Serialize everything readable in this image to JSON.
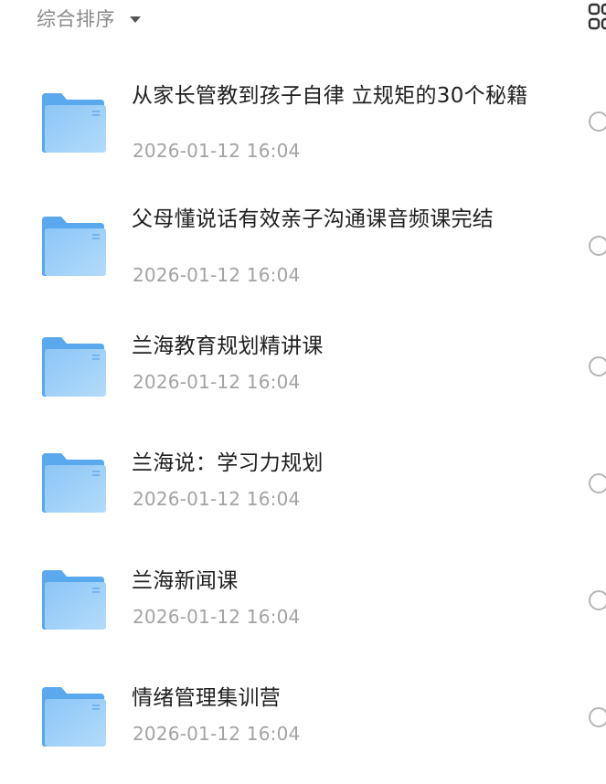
{
  "toolbar": {
    "sort_label": "综合排序",
    "sort_caret_icon": "caret-down-icon",
    "view_toggle_icon": "grid-view-icon"
  },
  "colors": {
    "folder_back": "#5aa9ef",
    "folder_front_top": "#8cc6f6",
    "folder_front_bottom": "#a7d4fa",
    "name_text": "#1f1f1f",
    "meta_text": "#a3a3a3",
    "sort_text": "#8a8a8a",
    "radio_border": "#b5b5b5"
  },
  "files": [
    {
      "name": "从家长管教到孩子自律 立规矩的30个秘籍",
      "date": "2026-01-12 16:04",
      "icon": "folder-icon"
    },
    {
      "name": "父母懂说话有效亲子沟通课音频课完结",
      "date": "2026-01-12 16:04",
      "icon": "folder-icon"
    },
    {
      "name": "兰海教育规划精讲课",
      "date": "2026-01-12 16:04",
      "icon": "folder-icon"
    },
    {
      "name": "兰海说：学习力规划",
      "date": "2026-01-12 16:04",
      "icon": "folder-icon"
    },
    {
      "name": "兰海新闻课",
      "date": "2026-01-12 16:04",
      "icon": "folder-icon"
    },
    {
      "name": "情绪管理集训营",
      "date": "2026-01-12 16:04",
      "icon": "folder-icon"
    }
  ]
}
